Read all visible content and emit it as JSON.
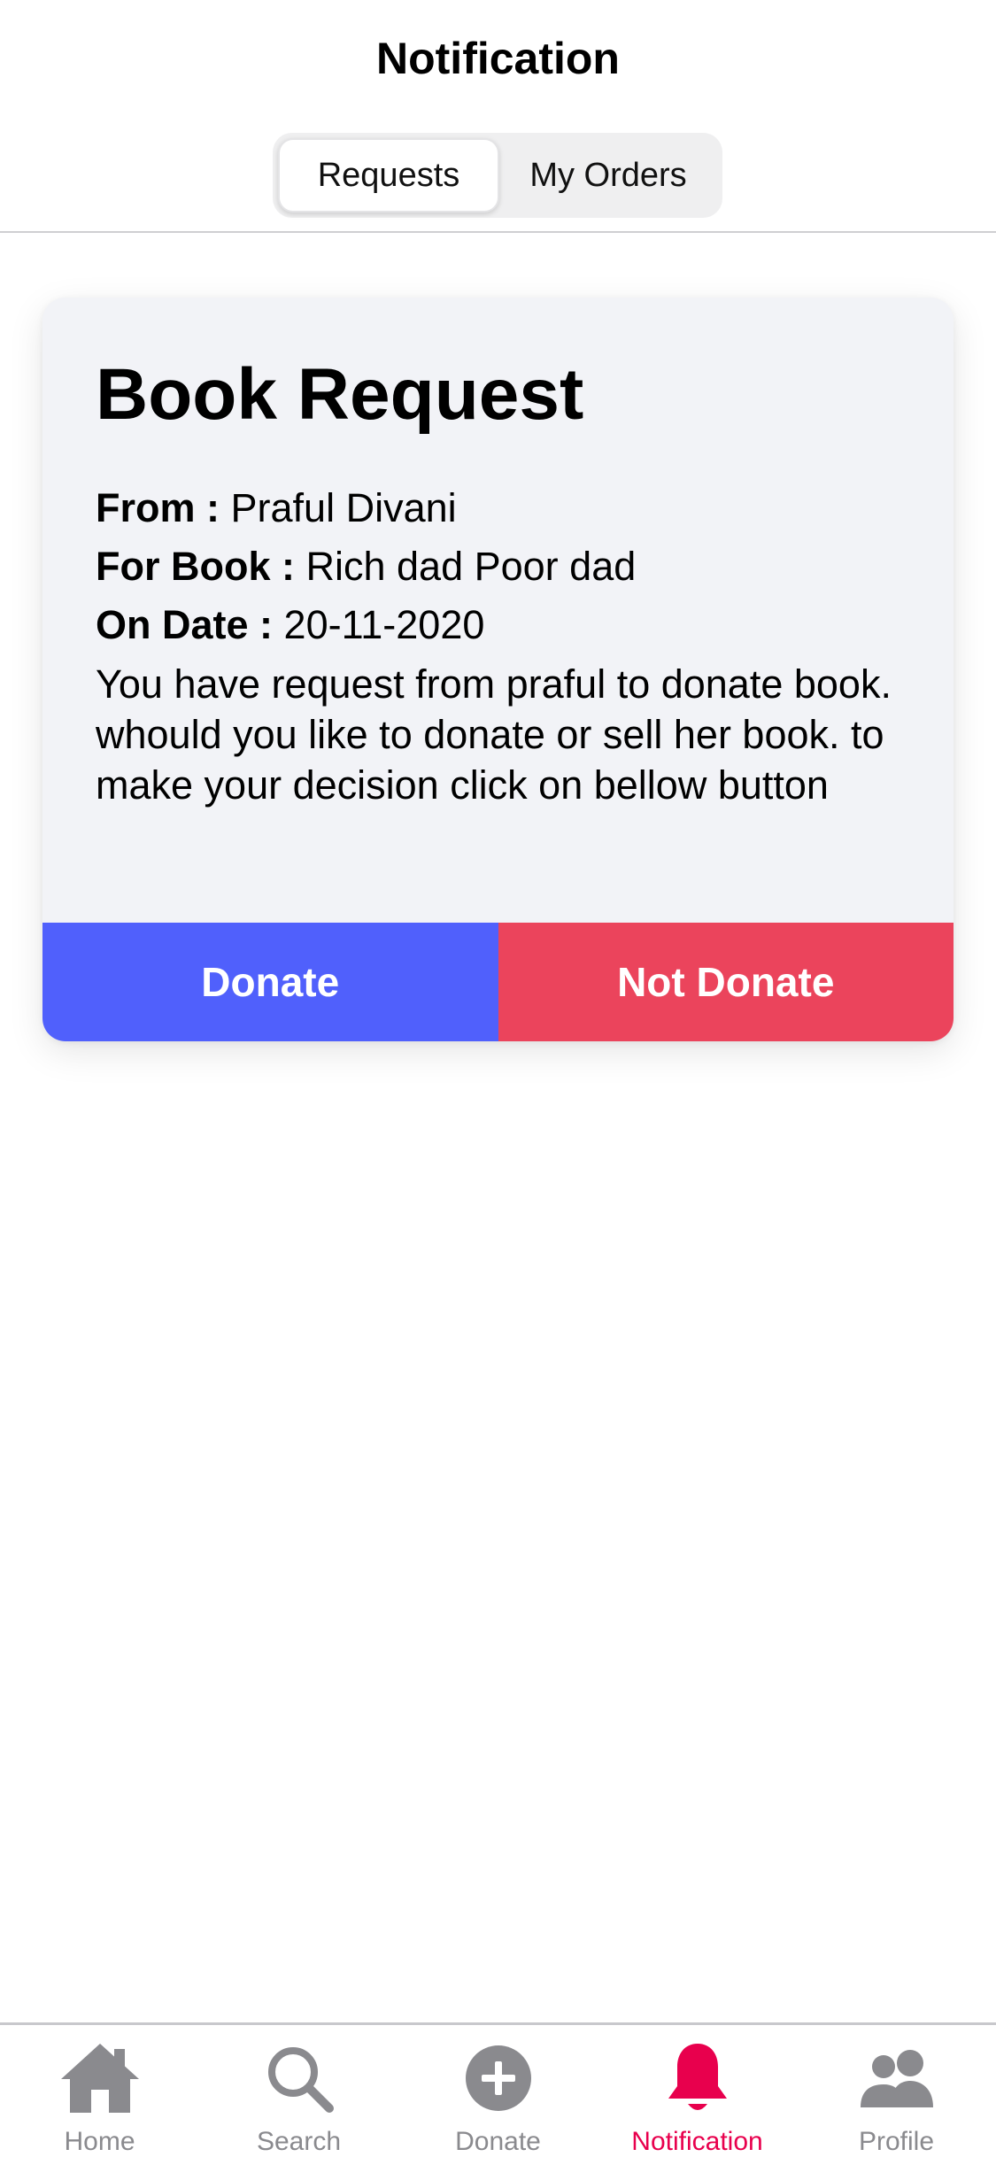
{
  "header": {
    "title": "Notification",
    "tabs": [
      {
        "label": "Requests",
        "active": true
      },
      {
        "label": "My Orders",
        "active": false
      }
    ]
  },
  "card": {
    "title": "Book Request",
    "from_key": "From :",
    "from_value": "Praful Divani",
    "book_key": "For Book :",
    "book_value": "Rich dad Poor dad",
    "date_key": "On Date :",
    "date_value": "20-11-2020",
    "message": "You have request from praful to donate book. whould you like to donate or sell her book. to make your decision click on bellow button",
    "donate_label": "Donate",
    "not_donate_label": "Not Donate"
  },
  "tabbar": {
    "items": [
      {
        "label": "Home",
        "icon": "home-icon",
        "active": false
      },
      {
        "label": "Search",
        "icon": "search-icon",
        "active": false
      },
      {
        "label": "Donate",
        "icon": "add-circle-icon",
        "active": false
      },
      {
        "label": "Notification",
        "icon": "bell-icon",
        "active": true
      },
      {
        "label": "Profile",
        "icon": "people-icon",
        "active": false
      }
    ]
  },
  "colors": {
    "donate_button": "#5060fc",
    "not_donate_button": "#eb445c",
    "active_tab": "#e8004d",
    "inactive_tab": "#8a8a8e",
    "card_background": "#f2f3f7"
  }
}
